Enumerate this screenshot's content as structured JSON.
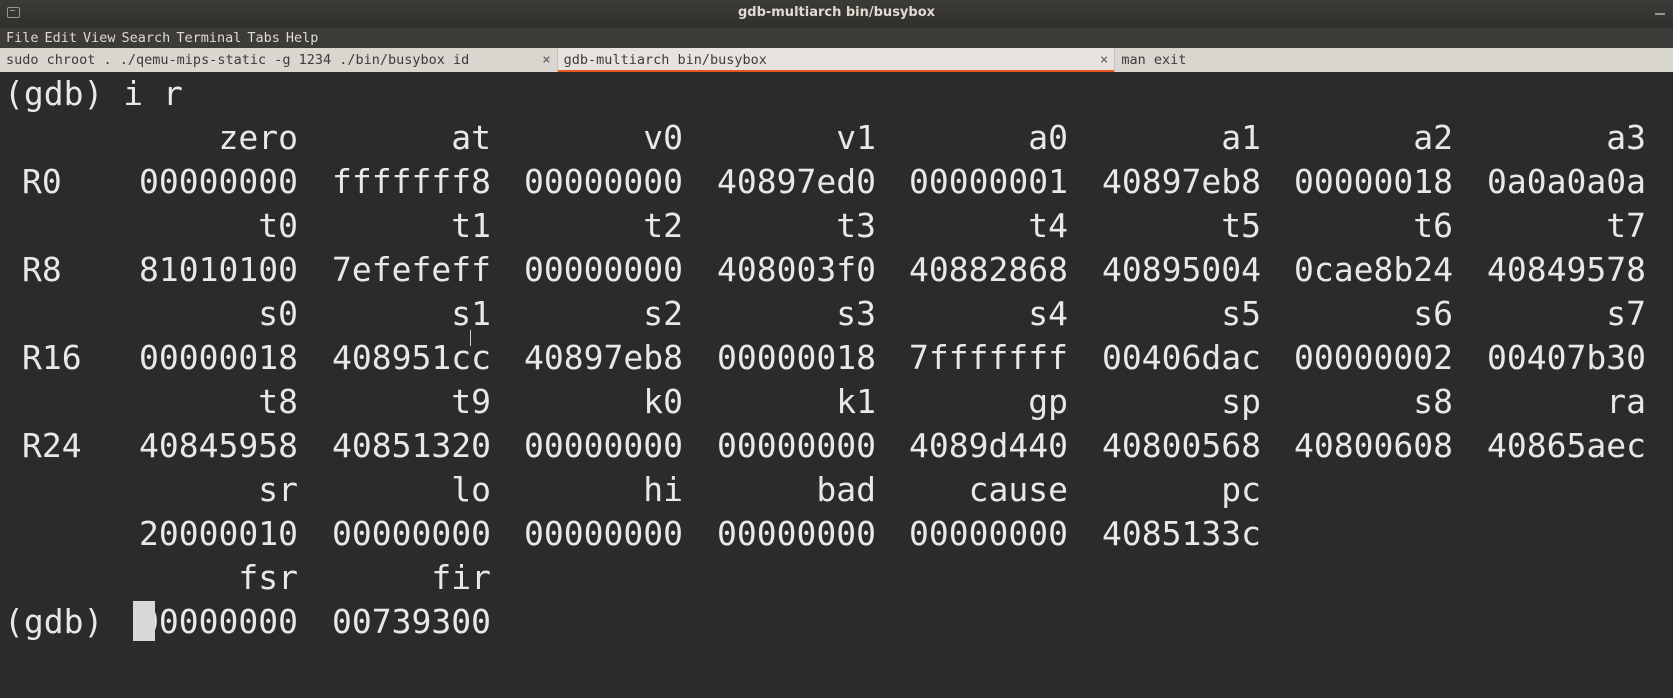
{
  "window": {
    "title": "gdb-multiarch bin/busybox"
  },
  "menu": {
    "items": [
      "File",
      "Edit",
      "View",
      "Search",
      "Terminal",
      "Tabs",
      "Help"
    ]
  },
  "tabs": [
    {
      "label": "sudo chroot . ./qemu-mips-static -g 1234 ./bin/busybox id",
      "close": "×"
    },
    {
      "label": "gdb-multiarch bin/busybox",
      "close": "×"
    },
    {
      "label": "man exit",
      "close": ""
    }
  ],
  "terminal": {
    "command_line": "(gdb) i r",
    "prompt": "(gdb) ",
    "rows": [
      {
        "label": "",
        "names": [
          "zero",
          "at",
          "v0",
          "v1",
          "a0",
          "a1",
          "a2",
          "a3"
        ]
      },
      {
        "label": "R0",
        "values": [
          "00000000",
          "fffffff8",
          "00000000",
          "40897ed0",
          "00000001",
          "40897eb8",
          "00000018",
          "0a0a0a0a"
        ]
      },
      {
        "label": "",
        "names": [
          "t0",
          "t1",
          "t2",
          "t3",
          "t4",
          "t5",
          "t6",
          "t7"
        ]
      },
      {
        "label": "R8",
        "values": [
          "81010100",
          "7efefeff",
          "00000000",
          "408003f0",
          "40882868",
          "40895004",
          "0cae8b24",
          "40849578"
        ]
      },
      {
        "label": "",
        "names": [
          "s0",
          "s1",
          "s2",
          "s3",
          "s4",
          "s5",
          "s6",
          "s7"
        ]
      },
      {
        "label": "R16",
        "values": [
          "00000018",
          "408951cc",
          "40897eb8",
          "00000018",
          "7fffffff",
          "00406dac",
          "00000002",
          "00407b30"
        ]
      },
      {
        "label": "",
        "names": [
          "t8",
          "t9",
          "k0",
          "k1",
          "gp",
          "sp",
          "s8",
          "ra"
        ]
      },
      {
        "label": "R24",
        "values": [
          "40845958",
          "40851320",
          "00000000",
          "00000000",
          "4089d440",
          "40800568",
          "40800608",
          "40865aec"
        ]
      },
      {
        "label": "",
        "names": [
          "sr",
          "lo",
          "hi",
          "bad",
          "cause",
          "pc"
        ]
      },
      {
        "label": "",
        "values": [
          "20000010",
          "00000000",
          "00000000",
          "00000000",
          "00000000",
          "4085133c"
        ]
      },
      {
        "label": "",
        "names": [
          "fsr",
          "fir"
        ]
      },
      {
        "label": "",
        "values": [
          "00000000",
          "00739300"
        ]
      }
    ]
  }
}
